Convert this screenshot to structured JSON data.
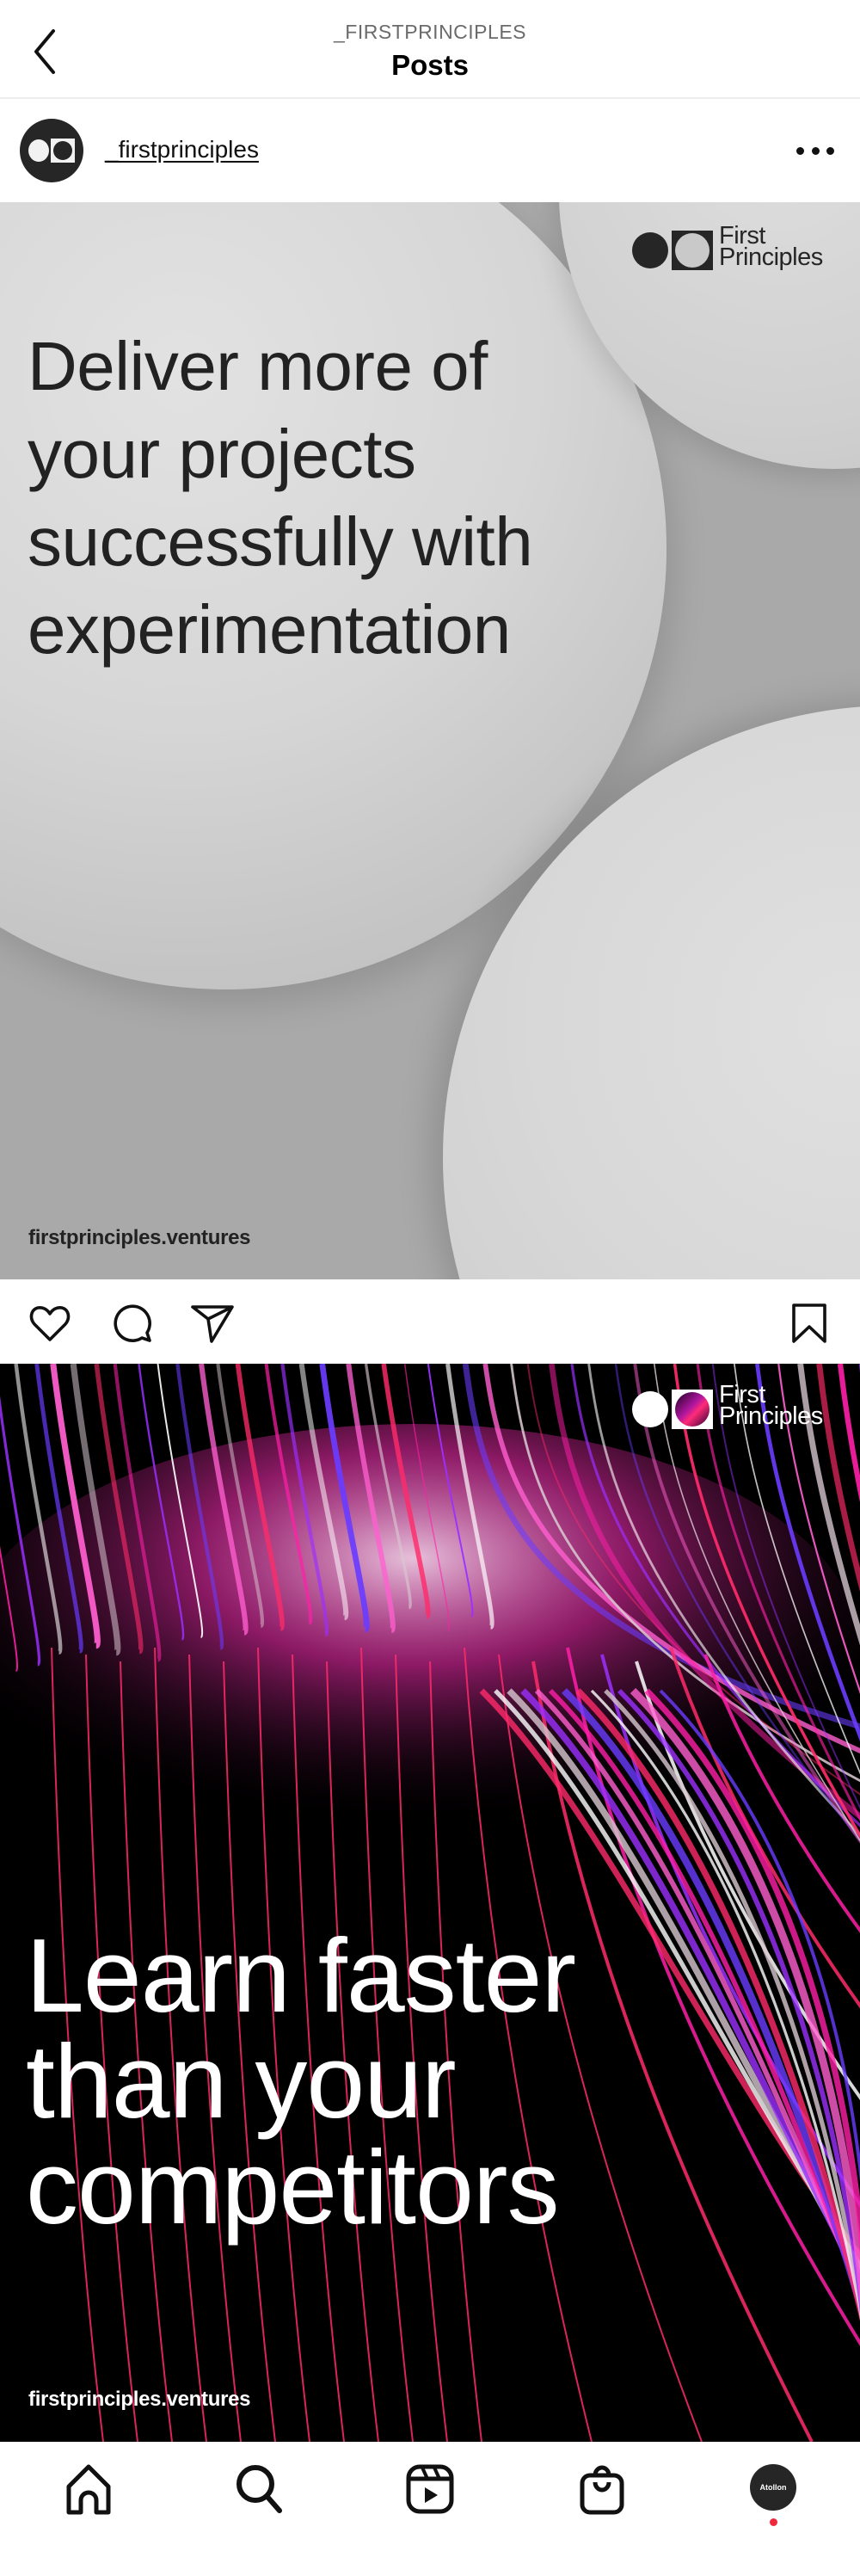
{
  "header": {
    "account_label": "_FIRSTPRINCIPLES",
    "title": "Posts",
    "back_icon": "chevron-left-icon"
  },
  "posts": [
    {
      "username": "_firstprinciples",
      "avatar_icon": "first-principles-logo-icon",
      "more_icon": "more-horizontal-icon",
      "image": {
        "theme": "light-gray-spheres",
        "brand_line1": "First",
        "brand_line2": "Principles",
        "headline_lines": [
          "Deliver more of",
          "your projects",
          "successfully with",
          "experimentation"
        ],
        "footer_url": "firstprinciples.ventures",
        "colors": {
          "background": "#a9a9a9",
          "text": "#222222"
        }
      },
      "actions": {
        "like_icon": "heart-icon",
        "comment_icon": "comment-bubble-icon",
        "share_icon": "send-paper-plane-icon",
        "save_icon": "bookmark-icon"
      }
    },
    {
      "image": {
        "theme": "neon-light-streaks",
        "brand_line1": "First",
        "brand_line2": "Principles",
        "headline_lines": [
          "Learn faster",
          "than your",
          "competitors"
        ],
        "footer_url": "firstprinciples.ventures",
        "colors": {
          "background": "#000000",
          "text": "#ffffff",
          "accent_magenta": "#ff1fa8",
          "accent_pink": "#ff2b6a",
          "accent_violet": "#9b30ff"
        }
      }
    }
  ],
  "bottom_nav": {
    "items": [
      {
        "name": "home",
        "icon": "home-icon"
      },
      {
        "name": "search",
        "icon": "search-icon"
      },
      {
        "name": "reels",
        "icon": "reels-icon"
      },
      {
        "name": "shop",
        "icon": "shopping-bag-icon"
      },
      {
        "name": "profile",
        "icon": "profile-avatar"
      }
    ],
    "profile_label": "Atollon",
    "notification_dot_color": "#f0283c"
  }
}
